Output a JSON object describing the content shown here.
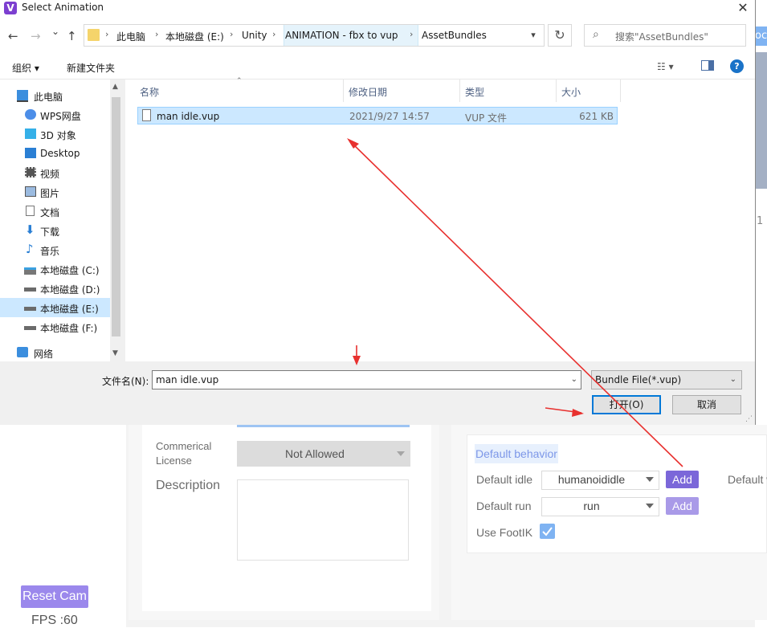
{
  "dialog": {
    "title": "Select Animation",
    "app_icon_letter": "V",
    "close_glyph": "✕",
    "nav": {
      "back": "←",
      "forward": "→",
      "recent": "⌄",
      "up": "↑"
    },
    "breadcrumbs": [
      "此电脑",
      "本地磁盘 (E:)",
      "Unity",
      "ANIMATION - fbx to vup",
      "AssetBundles"
    ],
    "breadcrumb_sep": "›",
    "refresh_glyph": "↻",
    "search_placeholder": "搜索\"AssetBundles\"",
    "toolbar": {
      "organize": "组织 ▾",
      "new_folder": "新建文件夹",
      "view_glyph": "☷ ▾",
      "pane_glyph": "▯",
      "help_glyph": "?"
    },
    "sidebar": [
      {
        "label": "此电脑",
        "icon": "computer-icon"
      },
      {
        "label": "WPS网盘",
        "icon": "cloud-icon"
      },
      {
        "label": "3D 对象",
        "icon": "cube-icon"
      },
      {
        "label": "Desktop",
        "icon": "desktop-icon"
      },
      {
        "label": "视频",
        "icon": "video-icon"
      },
      {
        "label": "图片",
        "icon": "picture-icon"
      },
      {
        "label": "文档",
        "icon": "document-icon"
      },
      {
        "label": "下载",
        "icon": "download-icon"
      },
      {
        "label": "音乐",
        "icon": "music-icon"
      },
      {
        "label": "本地磁盘 (C:)",
        "icon": "drive-c-icon"
      },
      {
        "label": "本地磁盘 (D:)",
        "icon": "drive-icon"
      },
      {
        "label": "本地磁盘 (E:)",
        "icon": "drive-icon",
        "selected": true
      },
      {
        "label": "本地磁盘 (F:)",
        "icon": "drive-icon"
      },
      {
        "label": "网络",
        "icon": "network-icon"
      }
    ],
    "columns": [
      "名称",
      "修改日期",
      "类型",
      "大小"
    ],
    "files": [
      {
        "name": "man idle.vup",
        "modified": "2021/9/27 14:57",
        "type": "VUP 文件",
        "size": "621 KB"
      }
    ],
    "filename_label": "文件名(N):",
    "filename_value": "man idle.vup",
    "filetype_value": "Bundle File(*.vup)",
    "open_button": "打开(O)",
    "cancel_button": "取消"
  },
  "background": {
    "commercial_license_label_1": "Commerical",
    "commercial_license_label_2": "License",
    "commercial_license_value": "Not Allowed",
    "description_label": "Description",
    "default_behavior_tab": "Default behavior",
    "default_idle_label": "Default idle",
    "default_idle_value": "humanoididle",
    "default_run_label": "Default run",
    "default_run_value": "run",
    "add_button": "Add",
    "use_footik_label": "Use FootIK",
    "default_right_label": "Default w",
    "reset_cam_button": "Reset Cam",
    "fps_text": "FPS :60",
    "edge_text_1": "oc",
    "edge_text_2": "1"
  },
  "colors": {
    "accent_purple": "#7b67d9",
    "accent_purple_light": "#a99ae8",
    "checkbox_blue": "#7fb3f2",
    "selection": "#cce8ff",
    "annotation_red": "#e8312f",
    "link_blue": "#7d97e8"
  }
}
